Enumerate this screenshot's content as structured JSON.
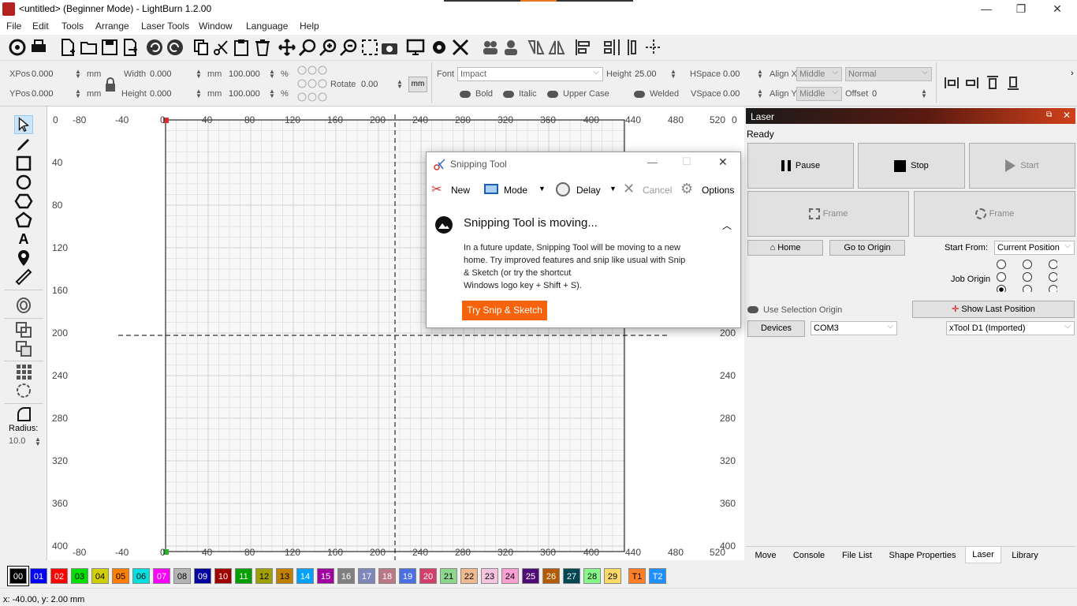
{
  "window": {
    "title": "<untitled> (Beginner Mode) - LightBurn 1.2.00",
    "minimize": "—",
    "maximize": "❐",
    "close": "✕"
  },
  "menu": [
    "File",
    "Edit",
    "Tools",
    "Arrange",
    "Laser Tools",
    "Window",
    "Language",
    "Help"
  ],
  "props": {
    "xpos_label": "XPos",
    "xpos_value": "0.000",
    "ypos_label": "YPos",
    "ypos_value": "0.000",
    "unit": "mm",
    "width_label": "Width",
    "width_value": "0.000",
    "height_label": "Height",
    "height_value": "0.000",
    "scale_w": "100.000",
    "scale_h": "100.000",
    "percent": "%",
    "rotate_label": "Rotate",
    "rotate_value": "0.00",
    "mm_button": "mm",
    "font_label": "Font",
    "font_value": "Impact",
    "fheight_label": "Height",
    "fheight_value": "25.00",
    "hspace_label": "HSpace",
    "hspace_value": "0.00",
    "vspace_label": "VSpace",
    "vspace_value": "0.00",
    "alignx_label": "Align X",
    "alignx_value": "Middle",
    "aligny_label": "Align Y",
    "aligny_value": "Middle",
    "normal_value": "Normal",
    "offset_label": "Offset",
    "offset_value": "0",
    "bold": "Bold",
    "italic": "Italic",
    "upper": "Upper Case",
    "welded": "Welded"
  },
  "lefttools": {
    "radius_label": "Radius:",
    "radius_value": "10.0"
  },
  "ruler": {
    "top": [
      "0",
      "-80",
      "-40",
      "0",
      "40",
      "80",
      "120",
      "160",
      "200",
      "240",
      "280",
      "320",
      "360",
      "400",
      "440",
      "480",
      "520"
    ],
    "bottom": [
      "-80",
      "-40",
      "0",
      "40",
      "80",
      "120",
      "160",
      "200",
      "240",
      "280",
      "320",
      "360",
      "400",
      "440",
      "480",
      "520"
    ],
    "left": [
      "40",
      "80",
      "120",
      "160",
      "200",
      "240",
      "280",
      "320",
      "360",
      "400"
    ],
    "right": [
      "0",
      "200",
      "240",
      "280",
      "320",
      "360",
      "400"
    ]
  },
  "laser": {
    "panel_title": "Laser",
    "status": "Ready",
    "pause": "Pause",
    "stop": "Stop",
    "start": "Start",
    "frame1": "Frame",
    "frame2": "Frame",
    "home": "Home",
    "go_origin": "Go to Origin",
    "start_from_label": "Start From:",
    "start_from_value": "Current Position",
    "job_origin_label": "Job Origin",
    "use_selection": "Use Selection Origin",
    "show_last": "Show Last Position",
    "devices": "Devices",
    "port": "COM3",
    "device": "xTool D1 (Imported)",
    "tabs": [
      "Move",
      "Console",
      "File List",
      "Shape Properties",
      "Laser",
      "Library"
    ]
  },
  "palette": [
    {
      "label": "00",
      "color": "#000000",
      "text": "#ffffff"
    },
    {
      "label": "01",
      "color": "#0000ff",
      "text": "#ffffff"
    },
    {
      "label": "02",
      "color": "#ff0000",
      "text": "#ffffff"
    },
    {
      "label": "03",
      "color": "#00e000",
      "text": "#000000"
    },
    {
      "label": "04",
      "color": "#d0d000",
      "text": "#000000"
    },
    {
      "label": "05",
      "color": "#ff8000",
      "text": "#000000"
    },
    {
      "label": "06",
      "color": "#00e0e0",
      "text": "#000000"
    },
    {
      "label": "07",
      "color": "#ff00ff",
      "text": "#ffffff"
    },
    {
      "label": "08",
      "color": "#b4b4b4",
      "text": "#000000"
    },
    {
      "label": "09",
      "color": "#0000a0",
      "text": "#ffffff"
    },
    {
      "label": "10",
      "color": "#a00000",
      "text": "#ffffff"
    },
    {
      "label": "11",
      "color": "#00a000",
      "text": "#ffffff"
    },
    {
      "label": "12",
      "color": "#a0a000",
      "text": "#000000"
    },
    {
      "label": "13",
      "color": "#c08000",
      "text": "#000000"
    },
    {
      "label": "14",
      "color": "#00a0ff",
      "text": "#ffffff"
    },
    {
      "label": "15",
      "color": "#a000a0",
      "text": "#ffffff"
    },
    {
      "label": "16",
      "color": "#808080",
      "text": "#ffffff"
    },
    {
      "label": "17",
      "color": "#7d87b9",
      "text": "#ffffff"
    },
    {
      "label": "18",
      "color": "#bb7784",
      "text": "#ffffff"
    },
    {
      "label": "19",
      "color": "#4a6fe3",
      "text": "#ffffff"
    },
    {
      "label": "20",
      "color": "#d33f6a",
      "text": "#ffffff"
    },
    {
      "label": "21",
      "color": "#8cd78c",
      "text": "#000000"
    },
    {
      "label": "22",
      "color": "#f0b98d",
      "text": "#000000"
    },
    {
      "label": "23",
      "color": "#f6c4e1",
      "text": "#000000"
    },
    {
      "label": "24",
      "color": "#fa9ed4",
      "text": "#000000"
    },
    {
      "label": "25",
      "color": "#500a78",
      "text": "#ffffff"
    },
    {
      "label": "26",
      "color": "#b45a00",
      "text": "#ffffff"
    },
    {
      "label": "27",
      "color": "#004754",
      "text": "#ffffff"
    },
    {
      "label": "28",
      "color": "#86fa88",
      "text": "#000000"
    },
    {
      "label": "29",
      "color": "#ffdb66",
      "text": "#000000"
    },
    {
      "label": "T1",
      "color": "#ff7f27",
      "text": "#000000"
    },
    {
      "label": "T2",
      "color": "#1e90ff",
      "text": "#ffffff"
    }
  ],
  "status": {
    "coords": "x: -40.00, y: 2.00 mm"
  },
  "snip": {
    "title": "Snipping Tool",
    "new": "New",
    "mode": "Mode",
    "delay": "Delay",
    "cancel": "Cancel",
    "options": "Options",
    "heading": "Snipping Tool is moving...",
    "body1": "In a future update, Snipping Tool will be moving to a new",
    "body2": "home. Try improved features and snip like usual with Snip",
    "body3": "& Sketch (or try the shortcut",
    "body4": "Windows logo key + Shift + S).",
    "try_button": "Try Snip & Sketch"
  }
}
